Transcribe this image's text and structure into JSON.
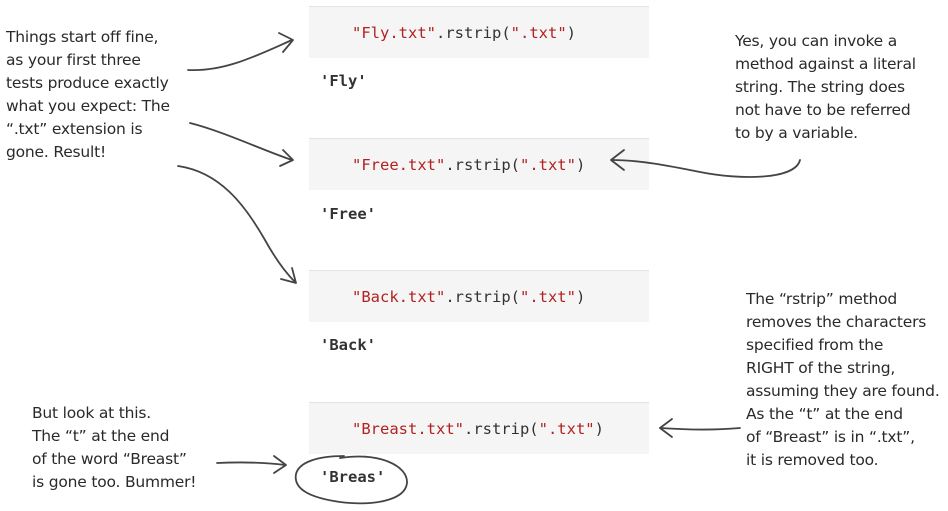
{
  "cells": [
    {
      "str1": "\"Fly.txt\"",
      "method": ".rstrip(",
      "str2": "\".txt\"",
      "close": ")",
      "output": "'Fly'"
    },
    {
      "str1": "\"Free.txt\"",
      "method": ".rstrip(",
      "str2": "\".txt\"",
      "close": ")",
      "output": "'Free'"
    },
    {
      "str1": "\"Back.txt\"",
      "method": ".rstrip(",
      "str2": "\".txt\"",
      "close": ")",
      "output": "'Back'"
    },
    {
      "str1": "\"Breast.txt\"",
      "method": ".rstrip(",
      "str2": "\".txt\"",
      "close": ")",
      "output": "'Breas'"
    }
  ],
  "notes": {
    "left_top": [
      "Things start off fine,",
      "as your first three",
      "tests produce exactly",
      "what you expect: The",
      "“.txt” extension is",
      "gone. Result!"
    ],
    "right_top": [
      "Yes, you can invoke a",
      "method against a literal",
      "string. The string does",
      "not have to be referred",
      "to by a variable."
    ],
    "right_bottom": [
      "The “rstrip” method",
      "removes the characters",
      "specified from the",
      "RIGHT of the string,",
      "assuming they are found.",
      "As the “t” at the end",
      "of “Breast” is in “.txt”,",
      "it is removed too."
    ],
    "left_bottom": [
      "But look at this.",
      "The “t” at the end",
      "of the word “Breast”",
      "is gone too. Bummer!"
    ]
  }
}
